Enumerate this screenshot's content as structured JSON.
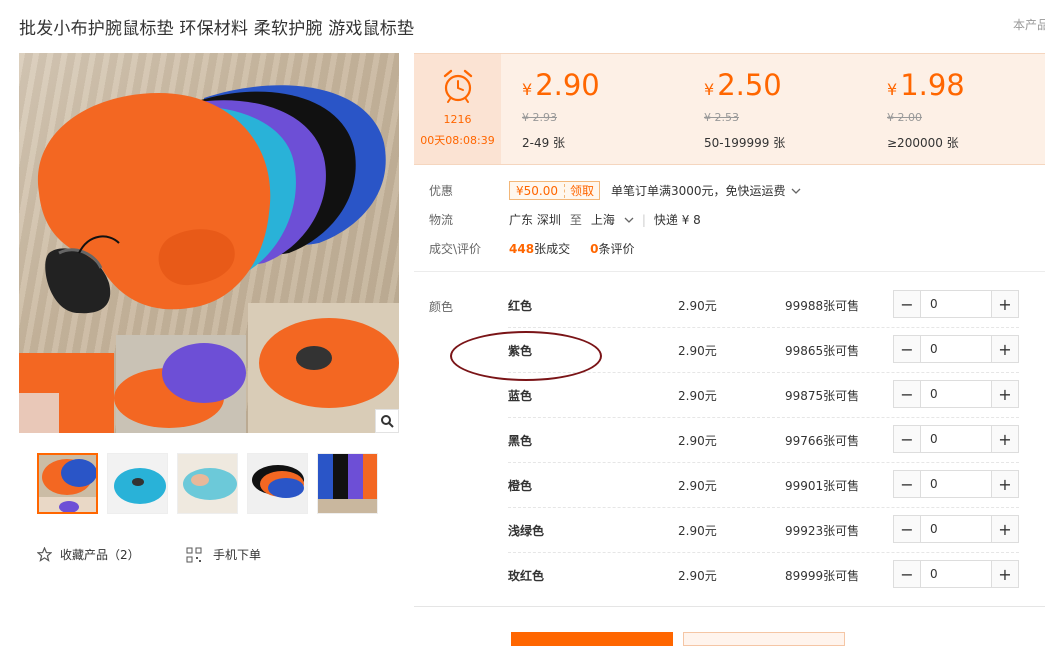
{
  "product": {
    "title": "批发小布护腕鼠标垫 环保材料 柔软护腕 游戏鼠标垫",
    "corner_text": "本产品"
  },
  "promo": {
    "count": "1216",
    "countdown": "00天08:08:39"
  },
  "price_tiers": [
    {
      "currency": "¥",
      "price": "2.90",
      "old_price": "¥ 2.93",
      "range": "2-49 张"
    },
    {
      "currency": "¥",
      "price": "2.50",
      "old_price": "¥ 2.53",
      "range": "50-199999 张"
    },
    {
      "currency": "¥",
      "price": "1.98",
      "old_price": "¥ 2.00",
      "range": "≥200000 张"
    }
  ],
  "discount": {
    "label": "优惠",
    "coupon_amount": "¥50.00",
    "coupon_action": "领取",
    "text": "单笔订单满3000元，免快运运费"
  },
  "logistics": {
    "label": "物流",
    "from": "广东 深圳",
    "to_word": "至",
    "to": "上海",
    "express": "快递 ¥ 8"
  },
  "sales": {
    "label": "成交\\评价",
    "deals_num": "448",
    "deals_text": "张成交",
    "reviews_num": "0",
    "reviews_text": "条评价"
  },
  "sku": {
    "label": "颜色",
    "rows": [
      {
        "color": "红色",
        "price": "2.90元",
        "stock": "99988张可售",
        "qty": "0"
      },
      {
        "color": "紫色",
        "price": "2.90元",
        "stock": "99865张可售",
        "qty": "0"
      },
      {
        "color": "蓝色",
        "price": "2.90元",
        "stock": "99875张可售",
        "qty": "0"
      },
      {
        "color": "黑色",
        "price": "2.90元",
        "stock": "99766张可售",
        "qty": "0"
      },
      {
        "color": "橙色",
        "price": "2.90元",
        "stock": "99901张可售",
        "qty": "0"
      },
      {
        "color": "浅绿色",
        "price": "2.90元",
        "stock": "99923张可售",
        "qty": "0"
      },
      {
        "color": "玫红色",
        "price": "2.90元",
        "stock": "89999张可售",
        "qty": "0"
      }
    ]
  },
  "actions": {
    "favorite": "收藏产品（2）",
    "mobile_order": "手机下单"
  },
  "colors": {
    "accent": "#ff6600",
    "price_bg": "#fdf0e6",
    "highlight_circle": "#7a1417"
  },
  "icons": [
    "alarm-clock-icon",
    "zoom-icon",
    "star-icon",
    "qr-code-icon",
    "chevron-down-icon",
    "minus-icon",
    "plus-icon"
  ]
}
